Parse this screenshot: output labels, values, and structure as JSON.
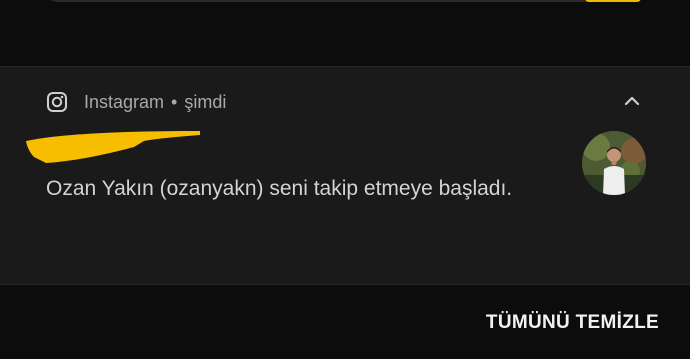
{
  "notification": {
    "app_name": "Instagram",
    "separator": "•",
    "time": "şimdi",
    "message": "Ozan Yakın (ozanyakn) seni takip etmeye başladı.",
    "app_icon": "instagram-icon",
    "expand_icon": "chevron-up-icon"
  },
  "footer": {
    "clear_all_label": "TÜMÜNÜ TEMİZLE"
  },
  "colors": {
    "background": "#0c0c0c",
    "card": "#1a1a1a",
    "redaction": "#f7bd00",
    "text_secondary": "#a9a9a9",
    "text_primary": "#d3d3d3"
  }
}
